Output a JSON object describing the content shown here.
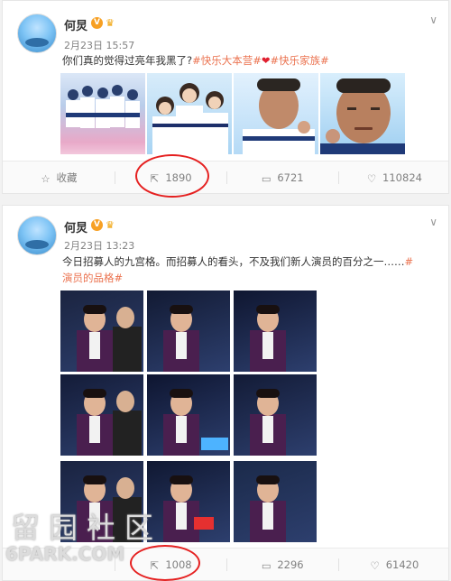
{
  "posts": [
    {
      "author": "何炅",
      "verified_label": "V",
      "time": "2月23日 15:57",
      "text_plain": "你们真的觉得过亮年我黑了?",
      "tag1": "#快乐大本营#",
      "heart": "❤",
      "tag2": "#快乐家族#",
      "actions": {
        "favorite_label": "收藏",
        "repost_count": "1890",
        "comment_count": "6721",
        "like_count": "110824"
      }
    },
    {
      "author": "何炅",
      "verified_label": "V",
      "time": "2月23日 13:23",
      "text_plain": "今日招募人的九宫格。而招募人的看头，不及我们新人演员的百分之一……",
      "tag1": "#演员的品格#",
      "actions": {
        "repost_count": "1008",
        "comment_count": "2296",
        "like_count": "61420"
      }
    }
  ],
  "watermark": {
    "cn": "留园社区",
    "en": "6PARK.COM"
  },
  "colors": {
    "tag": "#eb7350",
    "highlight_circle": "#e52020",
    "verified": "#f7a023"
  }
}
